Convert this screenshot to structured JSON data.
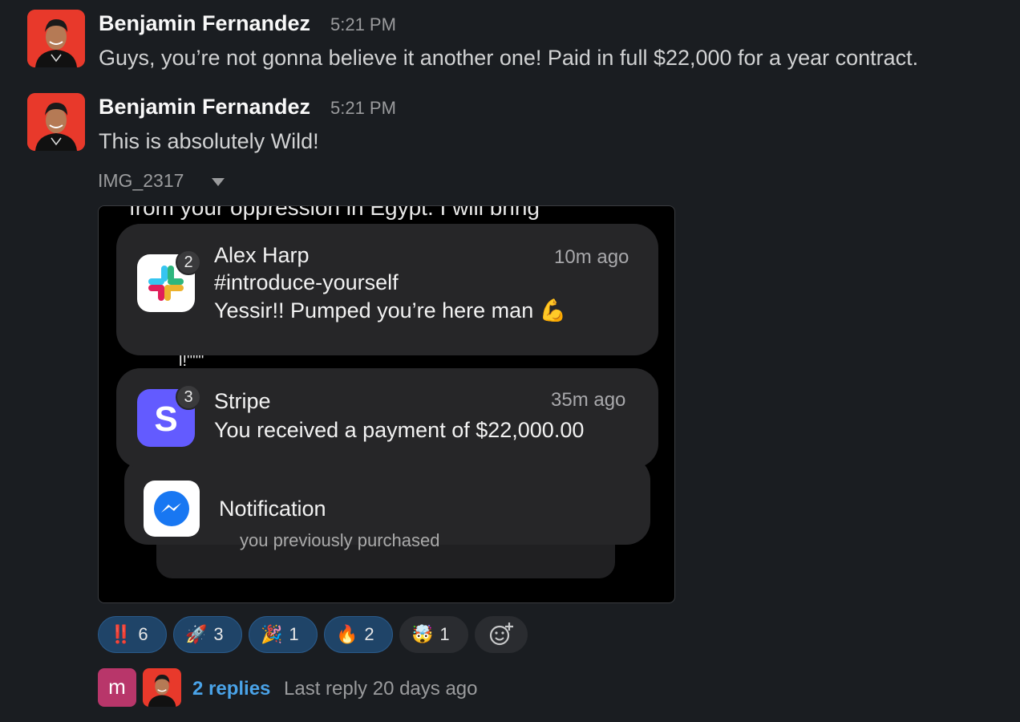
{
  "messages": [
    {
      "author": "Benjamin Fernandez",
      "time": "5:21 PM",
      "text": "Guys, you’re not gonna believe it another one! Paid in full $22,000 for a year contract."
    },
    {
      "author": "Benjamin Fernandez",
      "time": "5:21 PM",
      "text": "This is absolutely Wild!"
    }
  ],
  "attachment": {
    "filename": "IMG_2317",
    "background_text_top": "from your oppression in Egypt. I will bring",
    "background_text_mid": "l!\"\"\"",
    "notifications": [
      {
        "app": "Slack",
        "badge": "2",
        "title": "Alex Harp",
        "subtitle": "#introduce-yourself",
        "body": "Yessir!! Pumped you’re here man 💪",
        "time": "10m ago"
      },
      {
        "app": "Stripe",
        "badge": "3",
        "title": "Stripe",
        "body": "You received a payment of $22,000.00",
        "time": "35m ago"
      },
      {
        "app": "Messenger",
        "body": "Notification",
        "footer": "you previously purchased"
      }
    ]
  },
  "reactions": [
    {
      "emoji": "‼️",
      "count": "6",
      "active": true
    },
    {
      "emoji": "🚀",
      "count": "3",
      "active": true
    },
    {
      "emoji": "🎉",
      "count": "1",
      "active": true
    },
    {
      "emoji": "🔥",
      "count": "2",
      "active": true
    },
    {
      "emoji": "🤯",
      "count": "1",
      "active": false
    }
  ],
  "thread": {
    "avatar_letter": "m",
    "replies_label": "2 replies",
    "last_reply": "Last reply 20 days ago"
  },
  "colors": {
    "background": "#1a1d21",
    "avatar_red": "#e8392b",
    "link_blue": "#4aa3e8",
    "reaction_active": "#1f4468",
    "stripe_purple": "#635bff",
    "m_avatar": "#b8366a"
  }
}
